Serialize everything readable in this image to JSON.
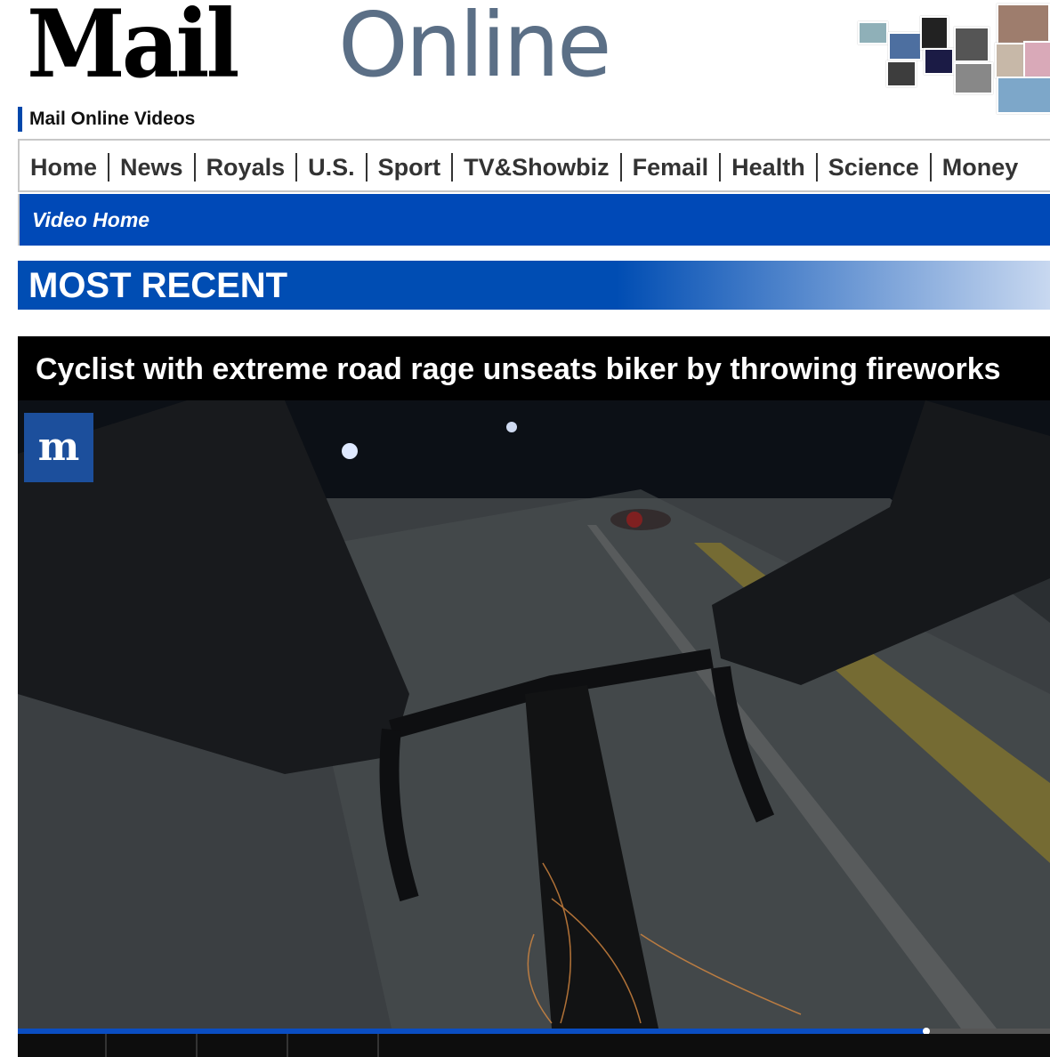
{
  "site": {
    "logo_mail": "Mail",
    "logo_online": "Online",
    "section_label": "Mail Online Videos"
  },
  "nav": {
    "items": [
      "Home",
      "News",
      "Royals",
      "U.S.",
      "Sport",
      "TV&Showbiz",
      "Femail",
      "Health",
      "Science",
      "Money"
    ],
    "sub_item": "Video Home"
  },
  "section": {
    "title": "MOST RECENT"
  },
  "video": {
    "headline": "Cyclist with extreme road rage unseats biker by throwing fireworks",
    "badge": "m",
    "progress": 0.88
  },
  "colors": {
    "brand_blue": "#0049b7",
    "online_grey": "#5b6f86"
  }
}
